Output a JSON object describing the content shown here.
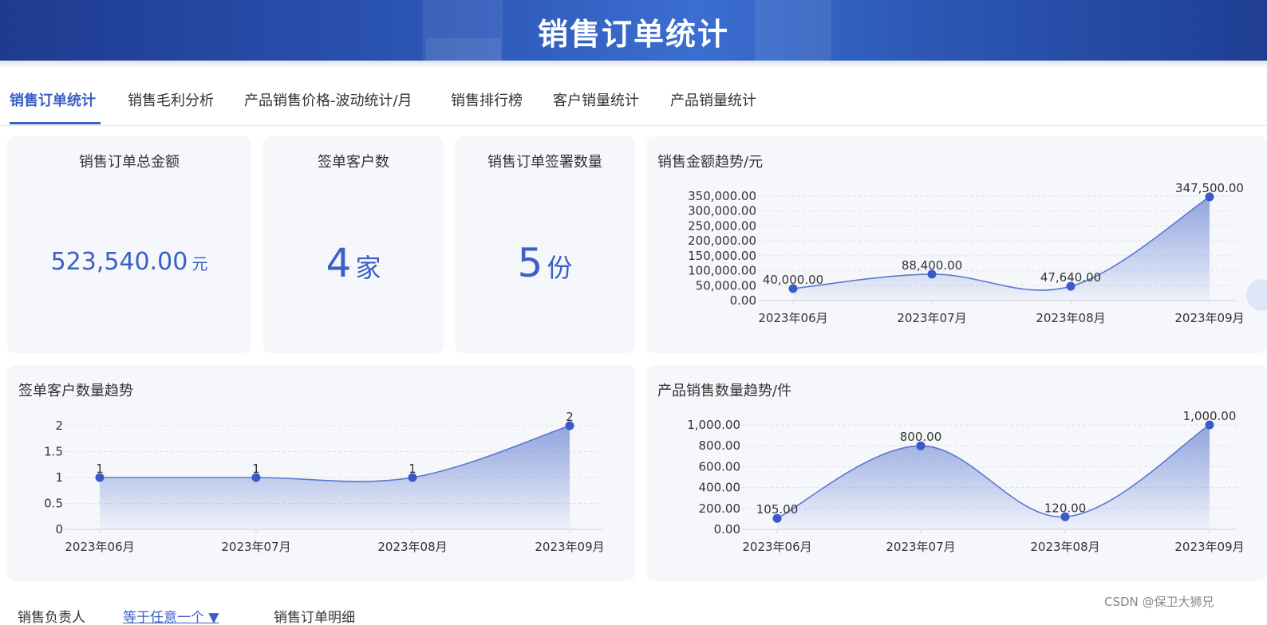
{
  "header": {
    "title": "销售订单统计"
  },
  "tabs": [
    {
      "label": "销售订单统计",
      "active": true
    },
    {
      "label": "销售毛利分析"
    },
    {
      "label": "产品销售价格-波动统计/月"
    },
    {
      "label": "销售排行榜"
    },
    {
      "label": "客户销量统计"
    },
    {
      "label": "产品销量统计"
    }
  ],
  "kpis": {
    "total_amount": {
      "title": "销售订单总金额",
      "value": "523,540.00",
      "unit": "元"
    },
    "customers": {
      "title": "签单客户数",
      "value": "4",
      "unit": "家"
    },
    "orders": {
      "title": "销售订单签署数量",
      "value": "5",
      "unit": "份"
    }
  },
  "charts": {
    "amount": {
      "title": "销售金额趋势/元"
    },
    "customers": {
      "title": "签单客户数量趋势"
    },
    "quantity": {
      "title": "产品销售数量趋势/件"
    }
  },
  "bottom": {
    "filter_label": "销售负责人",
    "filter_value": "等于任意一个",
    "detail_label": "销售订单明细"
  },
  "watermark": "CSDN @保卫大狮兄",
  "colors": {
    "accent": "#3b5fc6",
    "header": "#2c56b6"
  },
  "chart_data": [
    {
      "type": "area",
      "title": "销售金额趋势/元",
      "categories": [
        "2023年06月",
        "2023年07月",
        "2023年08月",
        "2023年09月"
      ],
      "values": [
        40000,
        88400,
        47640,
        347500
      ],
      "labels": [
        "40,000.00",
        "88,400.00",
        "47,640.00",
        "347,500.00"
      ],
      "yticks": [
        "0.00",
        "50,000.00",
        "100,000.00",
        "150,000.00",
        "200,000.00",
        "250,000.00",
        "300,000.00",
        "350,000.00"
      ],
      "ylim": [
        0,
        350000
      ],
      "grid": true
    },
    {
      "type": "area",
      "title": "签单客户数量趋势",
      "categories": [
        "2023年06月",
        "2023年07月",
        "2023年08月",
        "2023年09月"
      ],
      "values": [
        1,
        1,
        1,
        2
      ],
      "labels": [
        "1",
        "1",
        "1",
        "2"
      ],
      "yticks": [
        "0",
        "0.5",
        "1",
        "1.5",
        "2"
      ],
      "ylim": [
        0,
        2
      ],
      "grid": true
    },
    {
      "type": "area",
      "title": "产品销售数量趋势/件",
      "categories": [
        "2023年06月",
        "2023年07月",
        "2023年08月",
        "2023年09月"
      ],
      "values": [
        105,
        800,
        120,
        1000
      ],
      "labels": [
        "105.00",
        "800.00",
        "120.00",
        "1,000.00"
      ],
      "yticks": [
        "0.00",
        "200.00",
        "400.00",
        "600.00",
        "800.00",
        "1,000.00"
      ],
      "ylim": [
        0,
        1000
      ],
      "grid": true
    }
  ]
}
